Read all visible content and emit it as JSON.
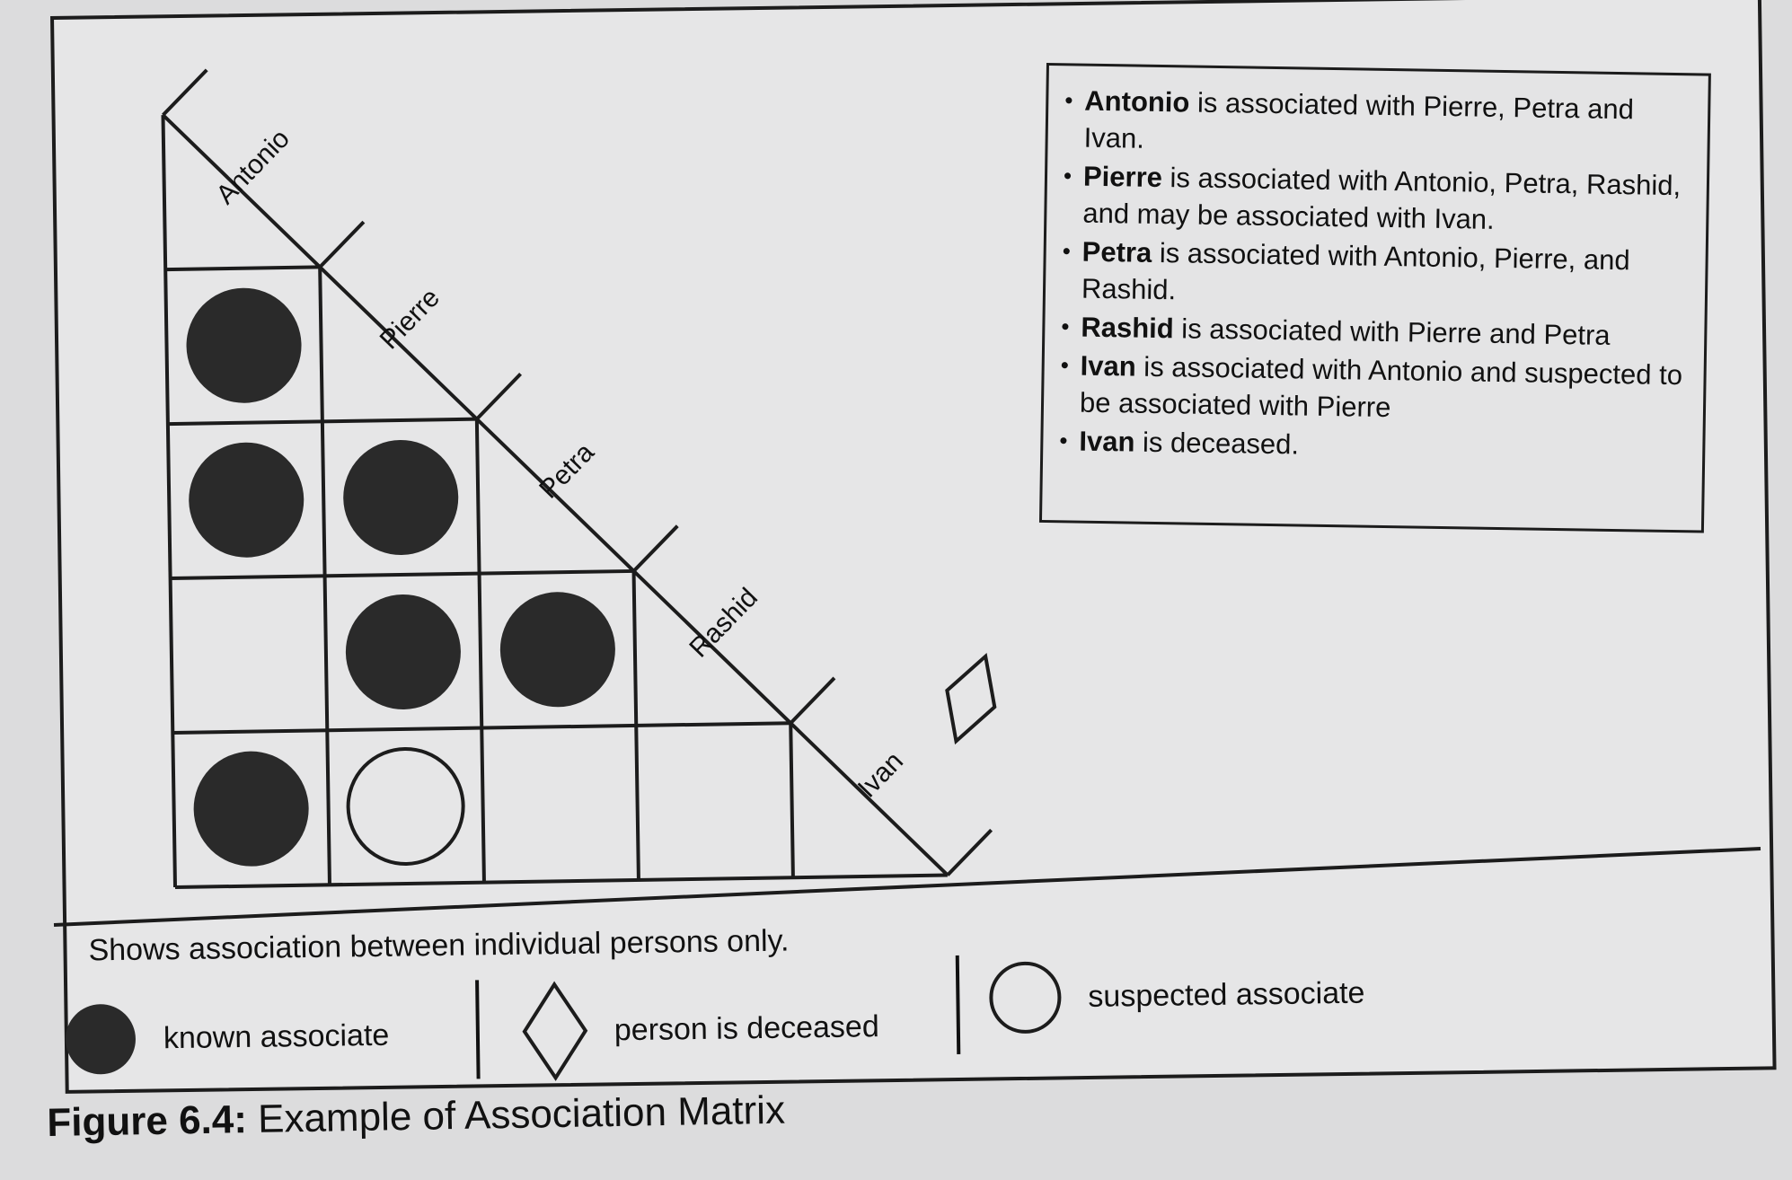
{
  "people": [
    "Antonio",
    "Pierre",
    "Petra",
    "Rashid",
    "Ivan"
  ],
  "matrix": {
    "rows": [
      {
        "person": "Pierre",
        "cells": [
          {
            "with": "Antonio",
            "mark": "known-associate"
          }
        ]
      },
      {
        "person": "Petra",
        "cells": [
          {
            "with": "Antonio",
            "mark": "known-associate"
          },
          {
            "with": "Pierre",
            "mark": "known-associate"
          }
        ]
      },
      {
        "person": "Rashid",
        "cells": [
          {
            "with": "Antonio",
            "mark": "none"
          },
          {
            "with": "Pierre",
            "mark": "known-associate"
          },
          {
            "with": "Petra",
            "mark": "known-associate"
          }
        ]
      },
      {
        "person": "Ivan",
        "cells": [
          {
            "with": "Antonio",
            "mark": "known-associate"
          },
          {
            "with": "Pierre",
            "mark": "suspected-associate"
          },
          {
            "with": "Petra",
            "mark": "none"
          },
          {
            "with": "Rashid",
            "mark": "none"
          }
        ]
      }
    ],
    "deceased": [
      "Ivan"
    ]
  },
  "info": [
    {
      "name": "Antonio",
      "text": " is associated with Pierre, Petra and Ivan."
    },
    {
      "name": "Pierre",
      "text": " is associated with Antonio, Petra, Rashid, and may be associated with Ivan."
    },
    {
      "name": "Petra",
      "text": " is associated with Antonio, Pierre, and Rashid."
    },
    {
      "name": "Rashid",
      "text": " is associated with Pierre and Petra"
    },
    {
      "name": "Ivan",
      "text": " is associated with Antonio and suspected to be associated with Pierre"
    },
    {
      "name": "Ivan",
      "text": " is deceased."
    }
  ],
  "legend": {
    "note": "Shows association between individual persons only.",
    "known": "known associate",
    "deceased": "person is deceased",
    "suspected": "suspected associate"
  },
  "caption": {
    "number": "Figure 6.4:",
    "title": "Example of Association Matrix"
  },
  "colors": {
    "ink": "#1c1c1c",
    "dot_fill": "#2a2a2a",
    "paper": "#e6e6e7"
  }
}
